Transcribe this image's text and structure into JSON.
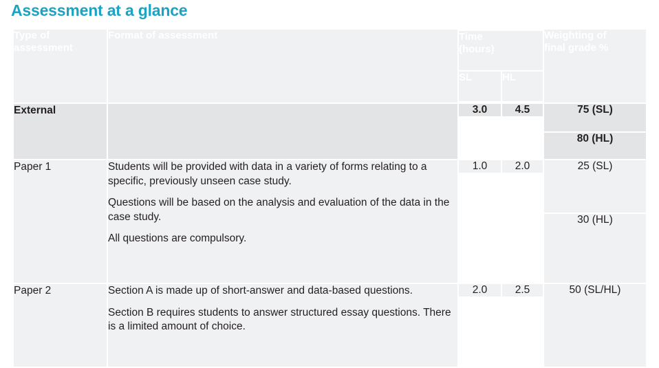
{
  "document": {
    "title": "Assessment at a glance"
  },
  "theme": {
    "accent": "#1CA3C4",
    "header_fill": "#14A3C7",
    "header_text": "#ffffff",
    "row_fill": "#f0f1f2",
    "summary_row_fill": "#e2e4e5",
    "body_text": "#231f20"
  },
  "table": {
    "headers": {
      "type_of_assessment": "Type of\nassessment",
      "type_of_assessment_line1": "Type of",
      "type_of_assessment_line2": "assessment",
      "format_of_assessment": "Format of assessment",
      "time_line1": "Time",
      "time_line2": "(hours)",
      "time_sl": "SL",
      "time_hl": "HL",
      "weighting_line1": "Weighting of",
      "weighting_line2": "final grade %"
    },
    "rows": [
      {
        "kind": "summary",
        "type": "External",
        "format_paragraphs": [],
        "sl": "3.0",
        "hl": "4.5",
        "weighting_parts": [
          "75 (SL)",
          "80 (HL)"
        ]
      },
      {
        "kind": "detail",
        "type": "Paper 1",
        "format_paragraphs": [
          "Students will be provided with data in a variety of forms relating to a specific, previously unseen case study.",
          "Questions will be based on the analysis and evaluation of the data in the case study.",
          "All questions are compulsory."
        ],
        "sl": "1.0",
        "hl": "2.0",
        "weighting_parts": [
          "25 (SL)",
          "30 (HL)"
        ]
      },
      {
        "kind": "detail",
        "type": "Paper 2",
        "format_paragraphs": [
          "Section A is made up of short-answer and data-based questions.",
          "Section B requires students to answer structured essay questions. There is a limited amount of choice."
        ],
        "sl": "2.0",
        "hl": "2.5",
        "weighting_parts": [
          "50 (SL/HL)"
        ]
      }
    ]
  }
}
